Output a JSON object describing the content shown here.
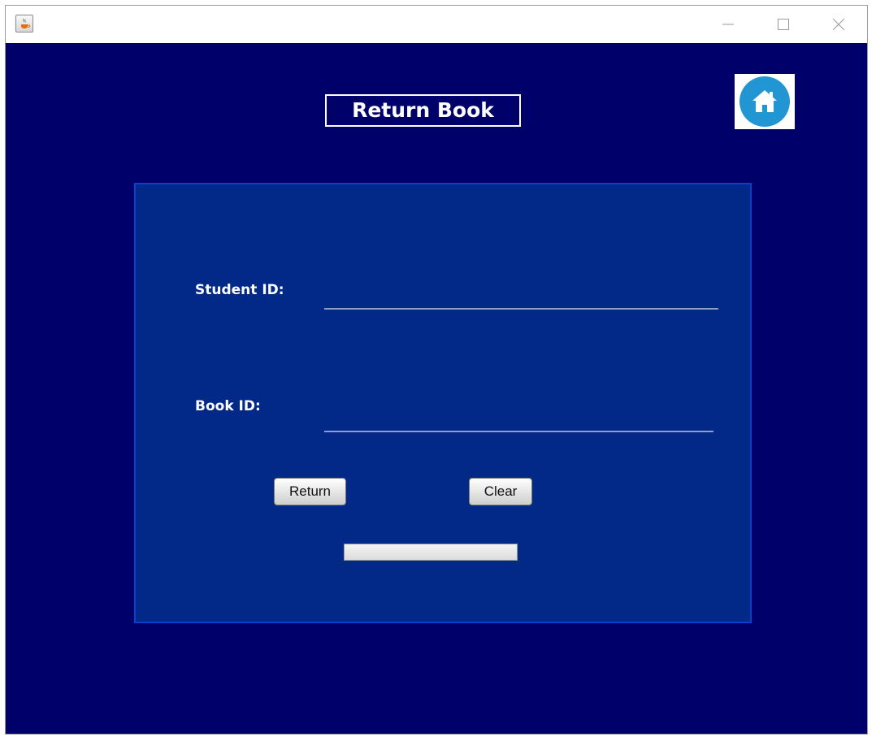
{
  "window": {
    "icon": "java-cup-icon",
    "controls": [
      "minimize-icon",
      "maximize-icon",
      "close-icon"
    ]
  },
  "header": {
    "title": "Return Book",
    "home_icon": "home-icon"
  },
  "form": {
    "student_id_label": "Student ID:",
    "student_id_value": "",
    "book_id_label": "Book ID:",
    "book_id_value": ""
  },
  "buttons": {
    "return_label": "Return",
    "clear_label": "Clear"
  },
  "progress": {
    "value": 0
  },
  "colors": {
    "background": "#00006b",
    "panel": "#022987",
    "panel_border": "#0a3fd0",
    "home_accent": "#2196d3"
  }
}
